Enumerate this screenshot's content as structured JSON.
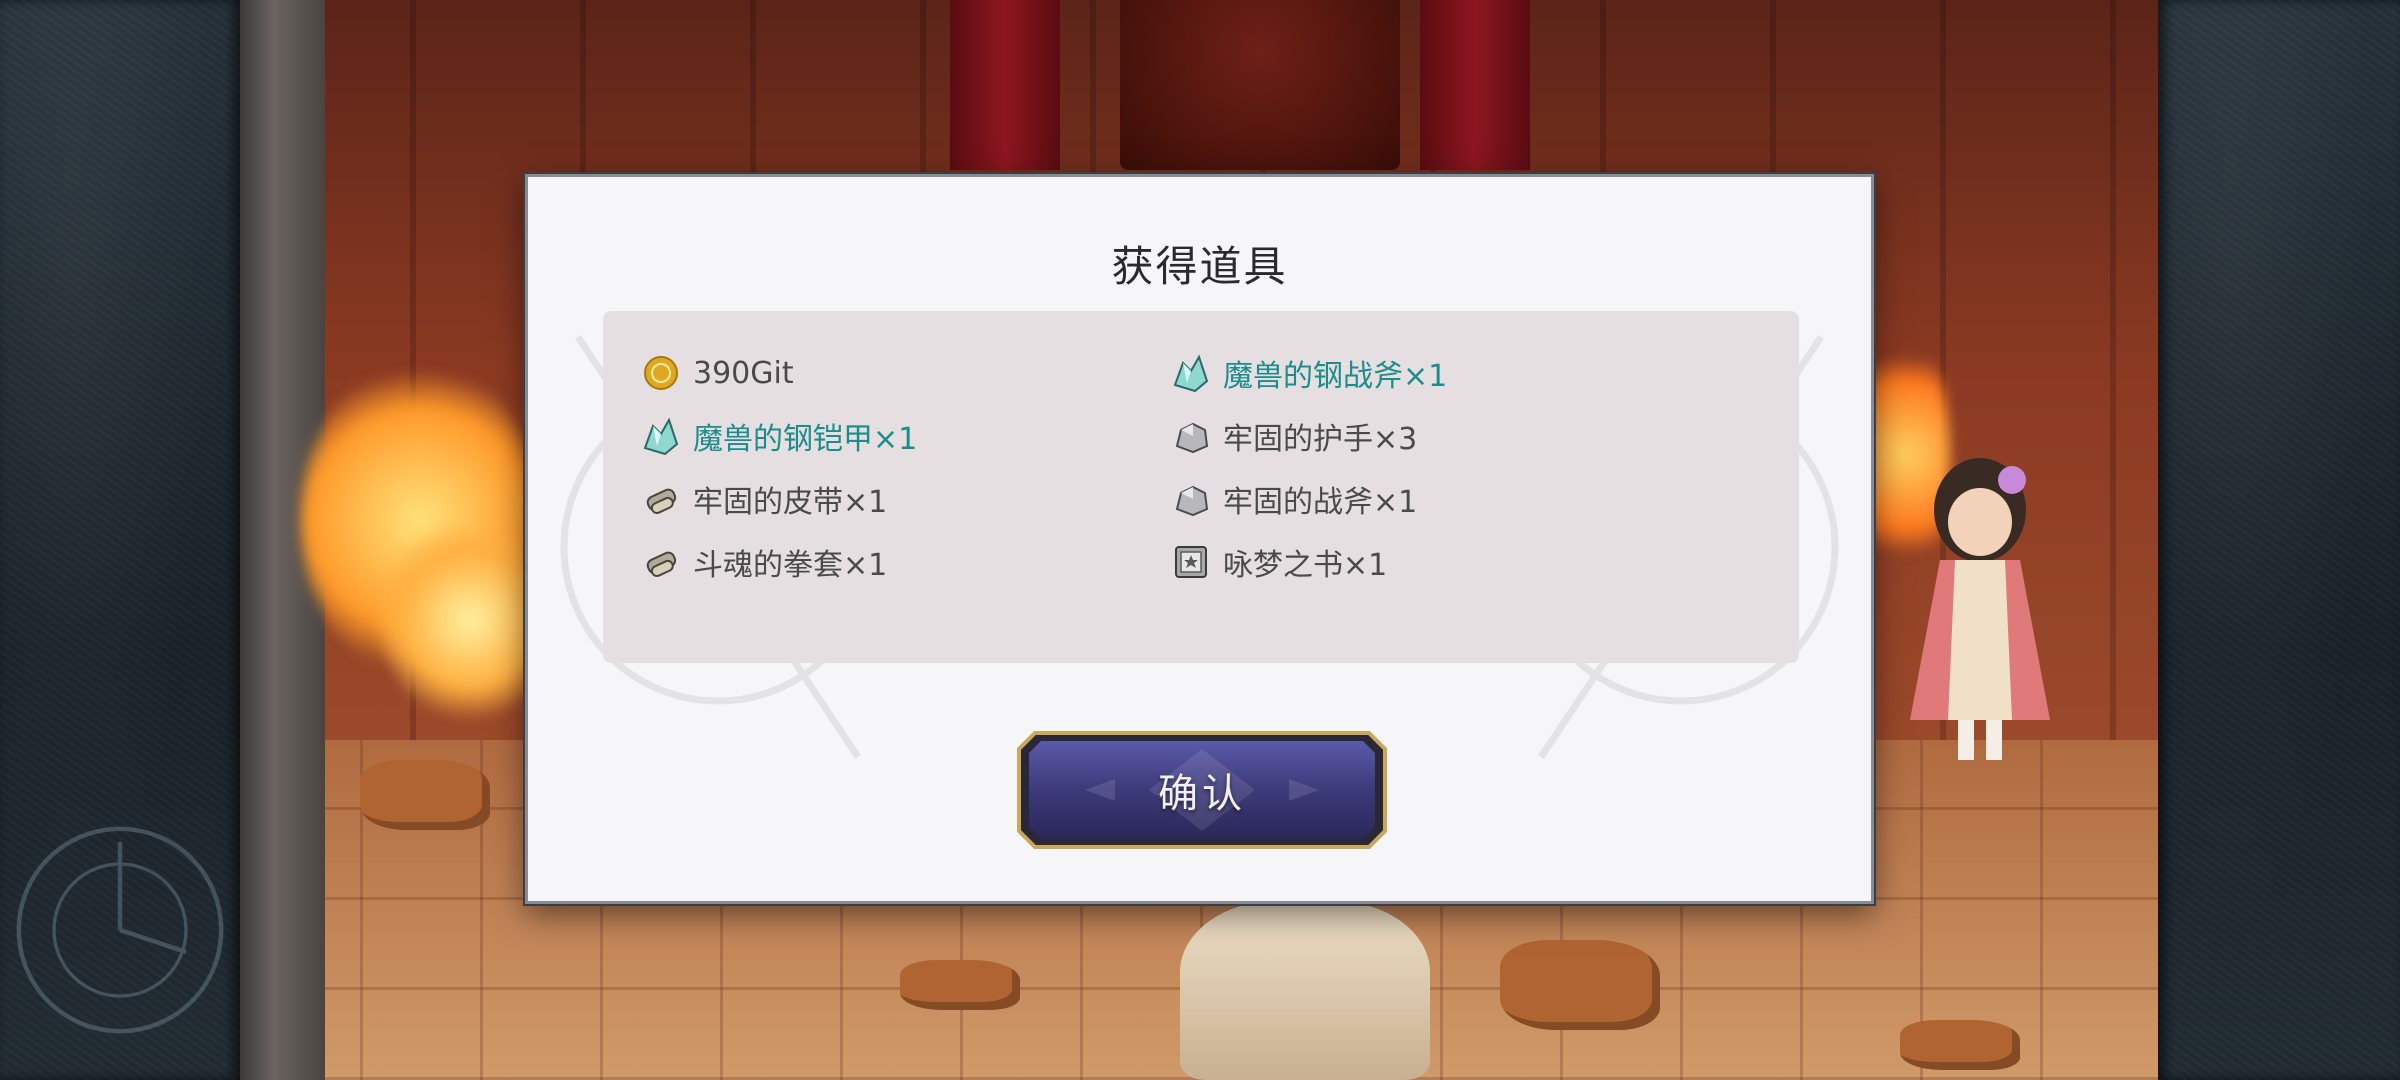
{
  "dialog": {
    "title": "获得道具",
    "confirm_label": "确认"
  },
  "items": [
    {
      "label": "390Git",
      "icon": "gold-coin-icon",
      "rarity": "common"
    },
    {
      "label": "魔兽的钢战斧×1",
      "icon": "crystal-ore-icon",
      "rarity": "rare"
    },
    {
      "label": "魔兽的钢铠甲×1",
      "icon": "crystal-ore-icon",
      "rarity": "rare"
    },
    {
      "label": "牢固的护手×3",
      "icon": "iron-ore-icon",
      "rarity": "common"
    },
    {
      "label": "牢固的皮带×1",
      "icon": "scroll-material-icon",
      "rarity": "common"
    },
    {
      "label": "牢固的战斧×1",
      "icon": "iron-ore-icon",
      "rarity": "common"
    },
    {
      "label": "斗魂的拳套×1",
      "icon": "scroll-material-icon",
      "rarity": "common"
    },
    {
      "label": "咏梦之书×1",
      "icon": "book-icon",
      "rarity": "common"
    }
  ],
  "colors": {
    "rare_text": "#1c8d8a",
    "common_text": "#4a4a4a",
    "panel_bg": "#e5dfe2",
    "dialog_bg": "#f6f5f7",
    "button_fill": "#3d3a7a",
    "button_border": "#c9a85a"
  }
}
